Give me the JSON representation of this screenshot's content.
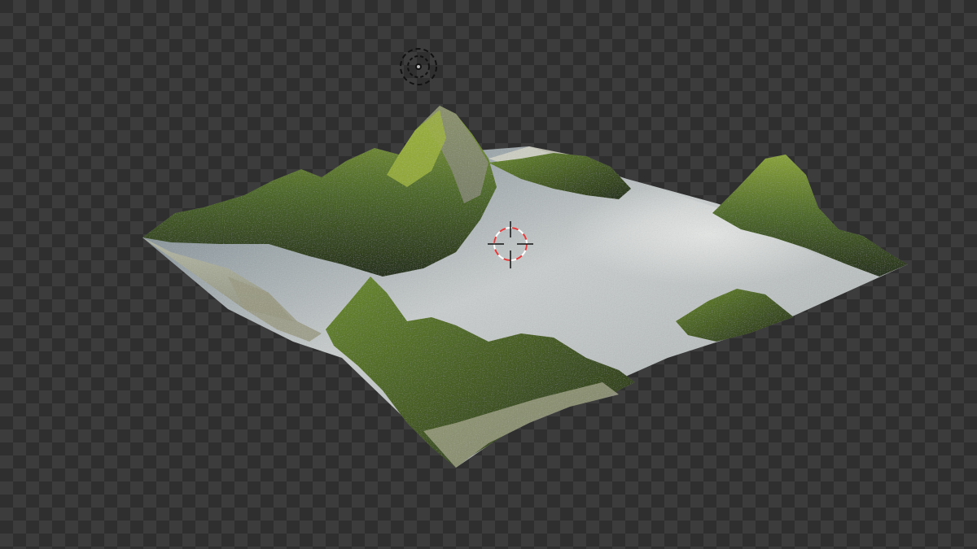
{
  "viewport": {
    "mode": "rendered-preview",
    "background": "transparent-checkerboard",
    "checker_colors": [
      "#2f2f2f",
      "#3c3c3c"
    ]
  },
  "scene": {
    "object": "terrain-mesh",
    "palette": {
      "grass_dark": "#2f3d1f",
      "grass": "#4f6a2a",
      "grass_light": "#8aa33a",
      "rock": "#8a8a7c",
      "snow": "#d8d8cc",
      "water_light": "#cfd3d4",
      "water": "#8f9aa0",
      "water_dark": "#5e6c73"
    }
  },
  "overlays": {
    "light_gizmo": "light-icon",
    "cursor": "3d-cursor-icon",
    "cursor_colors": [
      "#e23b3b",
      "#ffffff"
    ]
  }
}
